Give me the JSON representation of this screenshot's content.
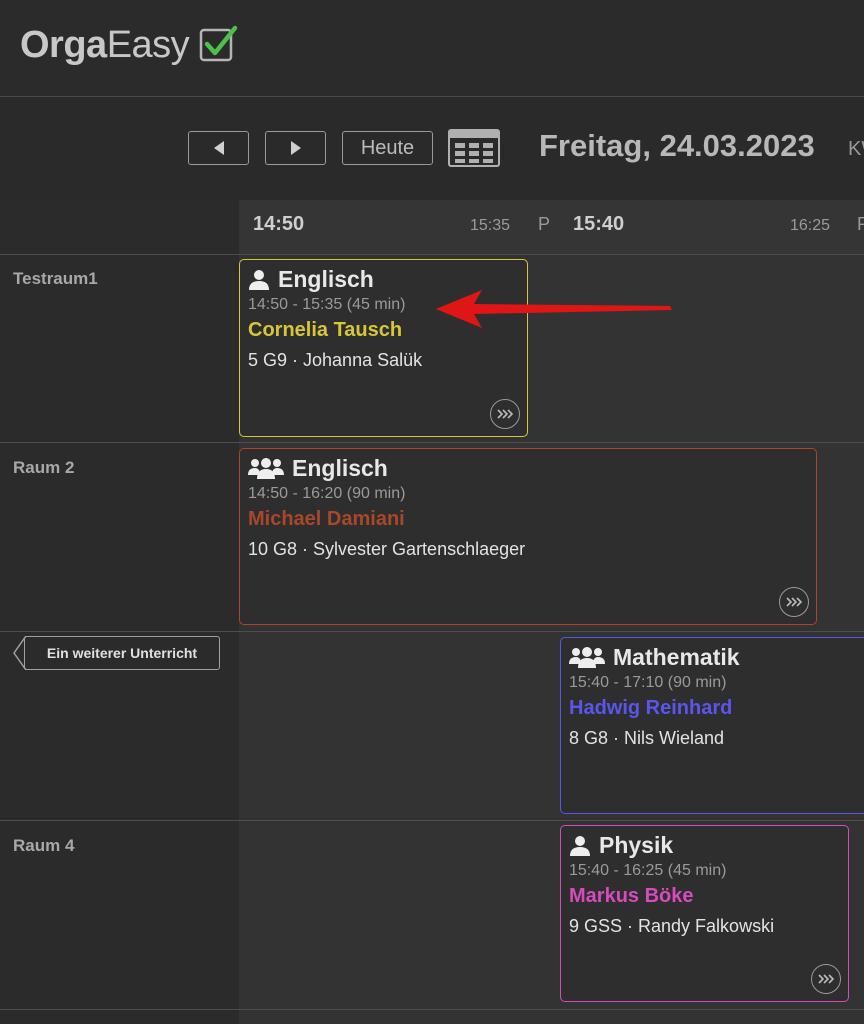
{
  "app": {
    "logo_bold": "Orga",
    "logo_light": "Easy"
  },
  "toolbar": {
    "prev_icon": "arrow-left-icon",
    "next_icon": "arrow-right-icon",
    "today_label": "Heute",
    "calendar_icon": "calendar-grid-icon",
    "date_title": "Freitag, 24.03.2023",
    "week_label": "KW"
  },
  "time_header": {
    "slot1_start": "14:50",
    "slot1_end": "15:35",
    "pause1": "P",
    "slot2_start": "15:40",
    "slot2_end": "16:25",
    "pause2": "P"
  },
  "rooms": [
    "Testraum1",
    "Raum 2",
    "Raum 4"
  ],
  "overflow_tag": "Ein weiterer Unterricht",
  "lessons": [
    {
      "icon": "single-person-icon",
      "subject": "Englisch",
      "time": "14:50 - 15:35  (45 min)",
      "teacher": "Cornelia Tausch",
      "cls": "5 G9 · Johanna Salük",
      "color": "#d6c63a"
    },
    {
      "icon": "group-icon",
      "subject": "Englisch",
      "time": "14:50 - 16:20  (90 min)",
      "teacher": "Michael Damiani",
      "cls": "10 G8 · Sylvester Gartenschlaeger",
      "color": "#a8472a"
    },
    {
      "icon": "group-icon",
      "subject": "Mathematik",
      "time": "15:40 - 17:10  (90 min)",
      "teacher": "Hadwig Reinhard",
      "cls": "8 G8 · Nils Wieland",
      "color": "#5b55ee"
    },
    {
      "icon": "single-person-icon",
      "subject": "Physik",
      "time": "15:40 - 16:25  (45 min)",
      "teacher": "Markus Böke",
      "cls": "9 GSS · Randy Falkowski",
      "color": "#d64bbd"
    }
  ],
  "colors": {
    "background": "#2b2b2b",
    "grid": "#333333",
    "arrow": "#e01515",
    "check": "#4bc14b"
  }
}
